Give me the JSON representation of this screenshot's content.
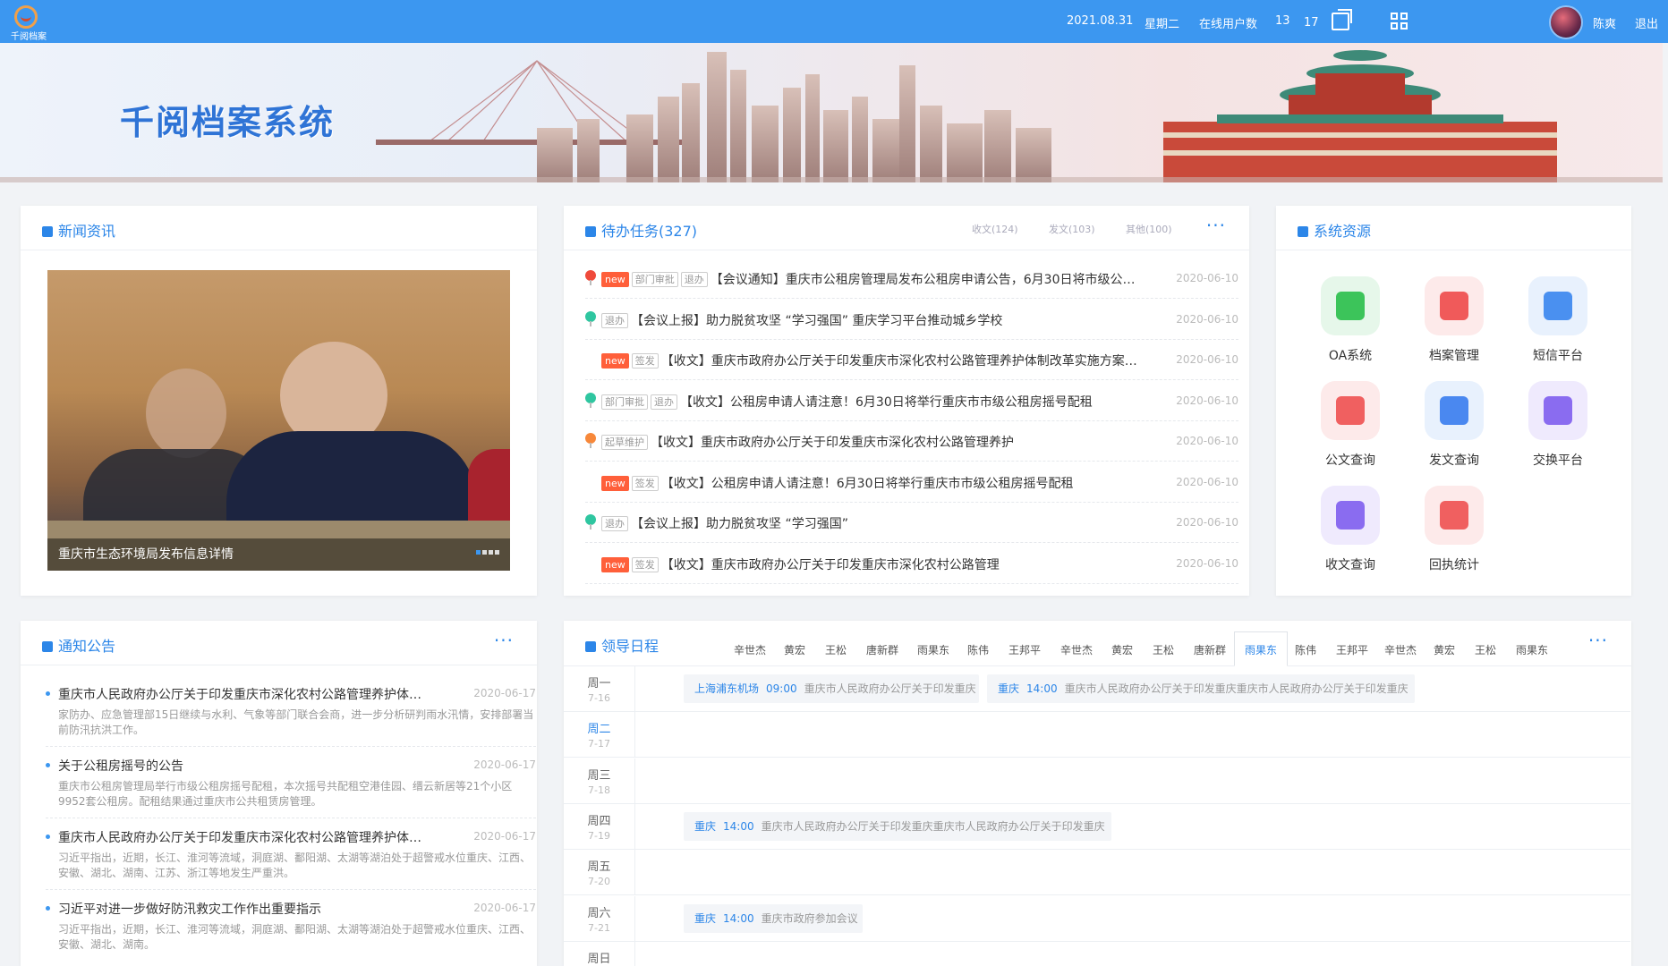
{
  "topbar": {
    "logo_text": "千阅档案",
    "date": "2021.08.31",
    "weekday": "星期二",
    "online_label": "在线用户数",
    "online_count": "13",
    "badge_count": "17",
    "username": "陈爽",
    "logout": "退出"
  },
  "banner": {
    "title": "千阅档案系统"
  },
  "news": {
    "title": "新闻资讯",
    "caption": "重庆市生态环境局发布信息详情"
  },
  "tasks": {
    "title": "待办任务(327)",
    "tab1": "收文(124)",
    "tab2": "发文(103)",
    "tab3": "其他(100)",
    "more": "···",
    "rows": [
      {
        "pin": "#ef4a3b",
        "tags": [
          "new",
          "部门审批",
          "退办"
        ],
        "text": "【会议通知】重庆市公租房管理局发布公租房申请公告，6月30日将市级公安...",
        "date": "2020-06-10"
      },
      {
        "pin": "#2fc6a0",
        "tags": [
          "退办"
        ],
        "text": "【会议上报】助力脱贫攻坚 “学习强国” 重庆学习平台推动城乡学校",
        "date": "2020-06-10"
      },
      {
        "pin": "",
        "tags": [
          "new",
          "签发"
        ],
        "text": "【收文】重庆市政府办公厅关于印发重庆市深化农村公路管理养护体制改革实施方案的...",
        "date": "2020-06-10"
      },
      {
        "pin": "#2fc6a0",
        "tags": [
          "部门审批",
          "退办"
        ],
        "text": "【收文】公租房申请人请注意！6月30日将举行重庆市市级公租房摇号配租",
        "date": "2020-06-10"
      },
      {
        "pin": "#f7883a",
        "tags": [
          "起草维护"
        ],
        "text": "【收文】重庆市政府办公厅关于印发重庆市深化农村公路管理养护",
        "date": "2020-06-10"
      },
      {
        "pin": "",
        "tags": [
          "new",
          "签发"
        ],
        "text": "【收文】公租房申请人请注意！6月30日将举行重庆市市级公租房摇号配租",
        "date": "2020-06-10"
      },
      {
        "pin": "#2fc6a0",
        "tags": [
          "退办"
        ],
        "text": "【会议上报】助力脱贫攻坚 “学习强国”",
        "date": "2020-06-10"
      },
      {
        "pin": "",
        "tags": [
          "new",
          "签发"
        ],
        "text": "【收文】重庆市政府办公厅关于印发重庆市深化农村公路管理",
        "date": "2020-06-10"
      }
    ]
  },
  "resources": {
    "title": "系统资源",
    "items": [
      {
        "label": "OA系统",
        "bg": "#e6f7ea",
        "fg": "#3cc45a",
        "icon": "windows-icon"
      },
      {
        "label": "档案管理",
        "bg": "#fdeaea",
        "fg": "#f05a5a",
        "icon": "server-icon"
      },
      {
        "label": "短信平台",
        "bg": "#e8f1fd",
        "fg": "#4a90f0",
        "icon": "message-icon"
      },
      {
        "label": "公文查询",
        "bg": "#fdeaea",
        "fg": "#f06060",
        "icon": "document-search-icon"
      },
      {
        "label": "发文查询",
        "bg": "#e8f1fd",
        "fg": "#4a88f0",
        "icon": "document-send-icon"
      },
      {
        "label": "交换平台",
        "bg": "#efeafd",
        "fg": "#8a6cf0",
        "icon": "exchange-icon"
      },
      {
        "label": "收文查询",
        "bg": "#efeafd",
        "fg": "#8a6cf0",
        "icon": "document-receive-icon"
      },
      {
        "label": "回执统计",
        "bg": "#fdeaea",
        "fg": "#f06060",
        "icon": "bar-chart-icon"
      }
    ]
  },
  "notices": {
    "title": "通知公告",
    "more": "···",
    "items": [
      {
        "title": "重庆市人民政府办公厅关于印发重庆市深化农村公路管理养护体制...",
        "date": "2020-06-17",
        "summary": "家防办、应急管理部15日继续与水利、气象等部门联合会商，进一步分析研判雨水汛情，安排部署当前防汛抗洪工作。"
      },
      {
        "title": "关于公租房摇号的公告",
        "date": "2020-06-17",
        "summary": "重庆市公租房管理局举行市级公租房摇号配租，本次摇号共配租空港佳园、缙云新居等21个小区9952套公租房。配租结果通过重庆市公共租赁房管理。"
      },
      {
        "title": "重庆市人民政府办公厅关于印发重庆市深化农村公路管理养护体制...",
        "date": "2020-06-17",
        "summary": "习近平指出，近期，长江、淮河等流域，洞庭湖、鄱阳湖、太湖等湖泊处于超警戒水位重庆、江西、安徽、湖北、湖南、江苏、浙江等地发生严重洪。"
      },
      {
        "title": "习近平对进一步做好防汛救灾工作作出重要指示",
        "date": "2020-06-17",
        "summary": "习近平指出，近期，长江、淮河等流域，洞庭湖、鄱阳湖、太湖等湖泊处于超警戒水位重庆、江西、安徽、湖北、湖南。"
      }
    ]
  },
  "schedule": {
    "title": "领导日程",
    "more": "···",
    "names": [
      "辛世杰",
      "黄宏",
      "王松",
      "唐新群",
      "雨果东",
      "陈伟",
      "王邦平",
      "辛世杰",
      "黄宏",
      "王松",
      "唐新群",
      "雨果东",
      "陈伟",
      "王邦平",
      "辛世杰",
      "黄宏",
      "王松",
      "雨果东"
    ],
    "active_index": 11,
    "days": [
      {
        "w": "周一",
        "d": "7-16",
        "active": false,
        "events": [
          {
            "loc": "上海浦东机场",
            "time": "09:00",
            "text": "重庆市人民政府办公厅关于印发重庆"
          },
          {
            "loc": "重庆",
            "time": "14:00",
            "text": "重庆市人民政府办公厅关于印发重庆重庆市人民政府办公厅关于印发重庆"
          }
        ]
      },
      {
        "w": "周二",
        "d": "7-17",
        "active": true,
        "events": []
      },
      {
        "w": "周三",
        "d": "7-18",
        "active": false,
        "events": []
      },
      {
        "w": "周四",
        "d": "7-19",
        "active": false,
        "events": [
          {
            "loc": "重庆",
            "time": "14:00",
            "text": "重庆市人民政府办公厅关于印发重庆重庆市人民政府办公厅关于印发重庆"
          }
        ]
      },
      {
        "w": "周五",
        "d": "7-20",
        "active": false,
        "events": []
      },
      {
        "w": "周六",
        "d": "7-21",
        "active": false,
        "events": [
          {
            "loc": "重庆",
            "time": "14:00",
            "text": "重庆市政府参加会议"
          }
        ]
      },
      {
        "w": "周日",
        "d": "",
        "active": false,
        "events": []
      }
    ]
  }
}
